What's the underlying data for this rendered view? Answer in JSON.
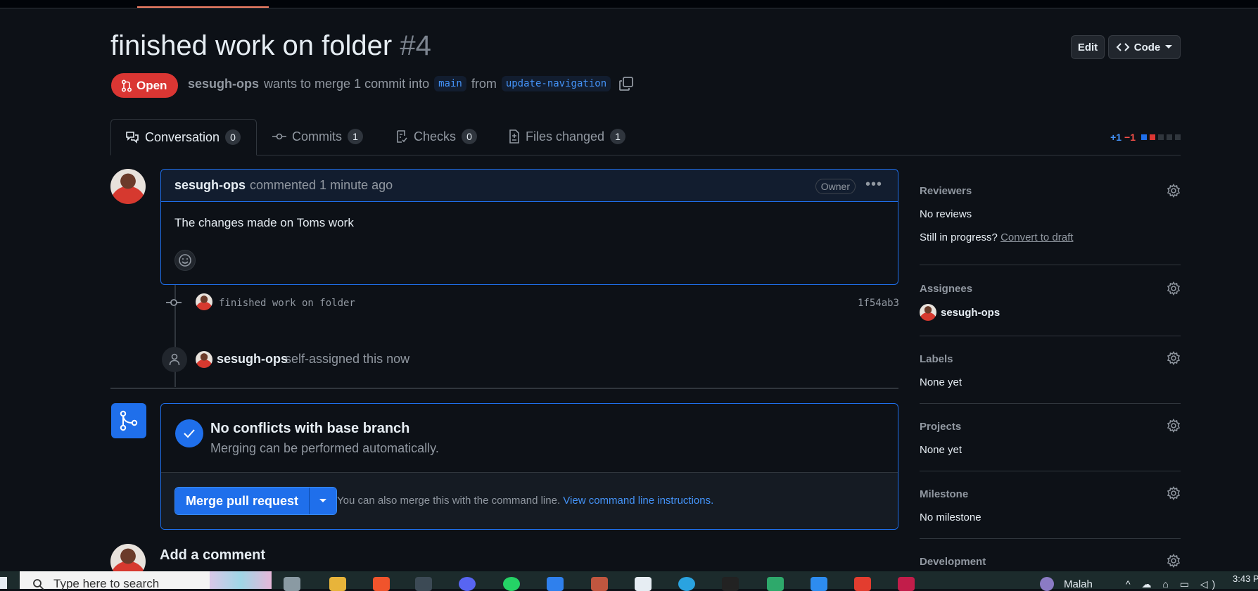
{
  "pr": {
    "title": "finished work on folder",
    "number": "#4",
    "state": "Open",
    "author": "sesugh-ops",
    "merge_text": "wants to merge 1 commit into",
    "base_branch": "main",
    "from_text": "from",
    "head_branch": "update-navigation"
  },
  "header_buttons": {
    "edit": "Edit",
    "code": "Code"
  },
  "tabs": [
    {
      "label": "Conversation",
      "count": "0"
    },
    {
      "label": "Commits",
      "count": "1"
    },
    {
      "label": "Checks",
      "count": "0"
    },
    {
      "label": "Files changed",
      "count": "1"
    }
  ],
  "diffstat": {
    "additions": "+1",
    "deletions": "−1"
  },
  "comment": {
    "author": "sesugh-ops",
    "action": "commented 1 minute ago",
    "badge": "Owner",
    "body": "The changes made on Toms work"
  },
  "timeline": {
    "commit_message": "finished work on folder",
    "commit_sha": "1f54ab3",
    "assign_user": "sesugh-ops",
    "assign_text": "self-assigned this now"
  },
  "merge": {
    "title": "No conflicts with base branch",
    "subtitle": "Merging can be performed automatically.",
    "button": "Merge pull request",
    "hint": "You can also merge this with the command line.",
    "hint_link": "View command line instructions."
  },
  "add_comment": "Add a comment",
  "sidebar": {
    "reviewers": {
      "heading": "Reviewers",
      "value": "No reviews",
      "draft_text": "Still in progress?",
      "draft_link": "Convert to draft"
    },
    "assignees": {
      "heading": "Assignees",
      "value": "sesugh-ops"
    },
    "labels": {
      "heading": "Labels",
      "value": "None yet"
    },
    "projects": {
      "heading": "Projects",
      "value": "None yet"
    },
    "milestone": {
      "heading": "Milestone",
      "value": "No milestone"
    },
    "development": {
      "heading": "Development"
    }
  },
  "taskbar": {
    "search_placeholder": "Type here to search",
    "tray_text": "Malah",
    "clock": "3:43 P"
  },
  "colors": {
    "background": "#0d1117",
    "accent": "#1f6feb",
    "open_state": "#da3633",
    "link": "#4493f8"
  }
}
